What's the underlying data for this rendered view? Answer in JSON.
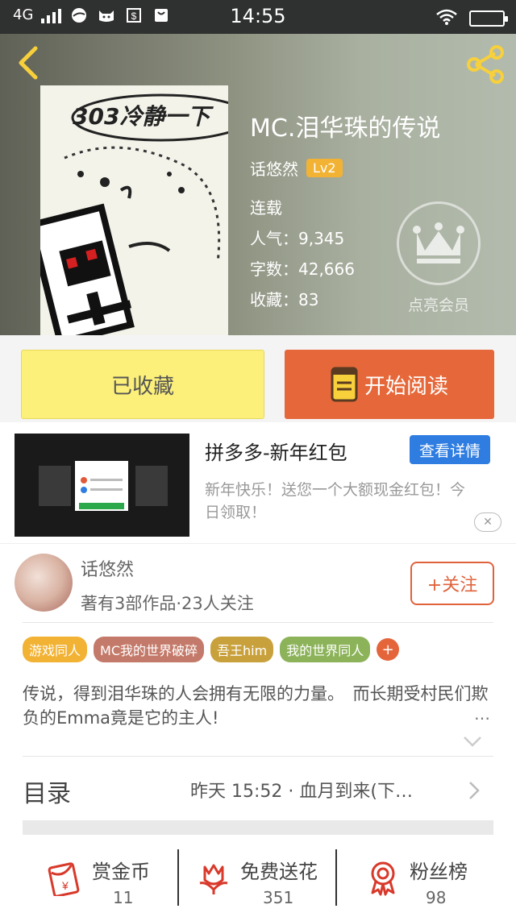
{
  "status_bar": {
    "network": "4G",
    "time": "14:55"
  },
  "book": {
    "title": "MC.泪华珠的传说",
    "author": "话悠然",
    "level": "Lv2",
    "status": "连载",
    "popularity": "人气：9,345",
    "word_count": "字数：42,666",
    "favorites": "收藏：83",
    "cover_text": "303冷静一下",
    "member_label": "点亮会员"
  },
  "actions": {
    "favorited_label": "已收藏",
    "read_label": "开始阅读"
  },
  "ad": {
    "title": "拼多多-新年红包",
    "detail_button": "查看详情",
    "description": "新年快乐！送您一个大额现金红包！今日领取！"
  },
  "author_info": {
    "name": "话悠然",
    "meta": "著有3部作品·23人关注",
    "follow_label": "+关注"
  },
  "tags": [
    {
      "label": "游戏同人",
      "color": "#f2b233"
    },
    {
      "label": "MC我的世界破碎",
      "color": "#c47a6a"
    },
    {
      "label": "吾王him",
      "color": "#c9a13c"
    },
    {
      "label": "我的世界同人",
      "color": "#8cb35a"
    }
  ],
  "tag_add_label": "+",
  "description": {
    "text": "传说，得到泪华珠的人会拥有无限的力量。　而长期受村民们欺负的Emma竟是它的主人!",
    "more": "…"
  },
  "toc": {
    "label": "目录",
    "latest": "昨天 15:52 · 血月到来(下…"
  },
  "bottom_stats": [
    {
      "label": "赏金币",
      "value": "11",
      "icon": "red-envelope-icon"
    },
    {
      "label": "免费送花",
      "value": "351",
      "icon": "flower-icon"
    },
    {
      "label": "粉丝榜",
      "value": "98",
      "icon": "medal-icon"
    }
  ],
  "colors": {
    "accent_orange": "#e6683a",
    "favorite_yellow": "#fcf07a",
    "ad_button_blue": "#2f7de1"
  }
}
